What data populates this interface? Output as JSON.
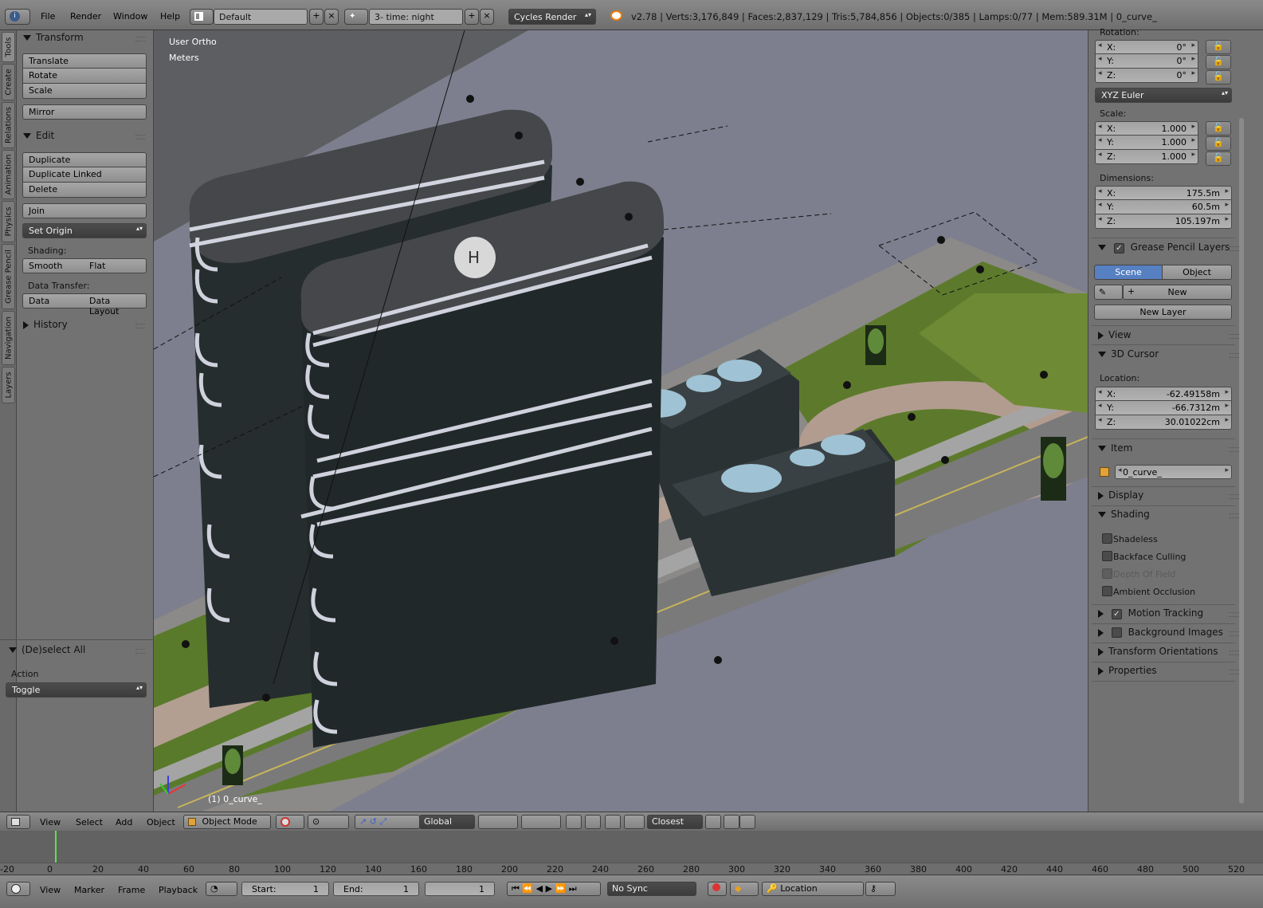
{
  "topbar": {
    "menus": [
      "File",
      "Render",
      "Window",
      "Help"
    ],
    "layout": "Default",
    "scene": "3- time: night",
    "engine": "Cycles Render",
    "stats": "v2.78 | Verts:3,176,849 | Faces:2,837,129 | Tris:5,784,856 | Objects:0/385 | Lamps:0/77 | Mem:589.31M | 0_curve_"
  },
  "tabs": [
    "Tools",
    "Create",
    "Relations",
    "Animation",
    "Physics",
    "Grease Pencil",
    "Navigation",
    "Layers"
  ],
  "toolshelf": {
    "transform": {
      "title": "Transform",
      "buttons": [
        "Translate",
        "Rotate",
        "Scale",
        "Mirror"
      ]
    },
    "edit": {
      "title": "Edit",
      "buttons": [
        "Duplicate",
        "Duplicate Linked",
        "Delete",
        "Join"
      ],
      "set_origin": "Set Origin"
    },
    "shading": {
      "label": "Shading:",
      "smooth": "Smooth",
      "flat": "Flat"
    },
    "data_transfer": {
      "label": "Data Transfer:",
      "data": "Data",
      "data_layout": "Data Layout"
    },
    "history": "History",
    "operator": {
      "title": "(De)select All",
      "action_label": "Action",
      "action_value": "Toggle"
    }
  },
  "viewport": {
    "view_name": "User Ortho",
    "units": "Meters",
    "object_label": "(1) 0_curve_"
  },
  "props": {
    "rotation": {
      "label": "Rotation:",
      "x": "0°",
      "y": "0°",
      "z": "0°",
      "mode": "XYZ Euler"
    },
    "scale": {
      "label": "Scale:",
      "x": "1.000",
      "y": "1.000",
      "z": "1.000"
    },
    "dimensions": {
      "label": "Dimensions:",
      "x": "175.5m",
      "y": "60.5m",
      "z": "105.197m"
    },
    "axis": {
      "x": "X:",
      "y": "Y:",
      "z": "Z:"
    },
    "grease_pencil": {
      "title": "Grease Pencil Layers",
      "scene": "Scene",
      "object": "Object",
      "new": "New",
      "new_layer": "New Layer"
    },
    "view": "View",
    "cursor": {
      "title": "3D Cursor",
      "location_label": "Location:",
      "x": "-62.49158m",
      "y": "-66.7312m",
      "z": "30.01022cm"
    },
    "item": {
      "title": "Item",
      "name": "0_curve_"
    },
    "display": "Display",
    "shading": {
      "title": "Shading",
      "shadeless": "Shadeless",
      "backface": "Backface Culling",
      "dof": "Depth Of Field",
      "ao": "Ambient Occlusion"
    },
    "motion_tracking": "Motion Tracking",
    "background_images": "Background Images",
    "transform_orientations": "Transform Orientations",
    "properties": "Properties"
  },
  "vpheader": {
    "menus": [
      "View",
      "Select",
      "Add",
      "Object"
    ],
    "mode": "Object Mode",
    "orientation": "Global",
    "snap": "Closest"
  },
  "timeline": {
    "ticks": [
      "-20",
      "0",
      "20",
      "40",
      "60",
      "80",
      "100",
      "120",
      "140",
      "160",
      "180",
      "200",
      "220",
      "240",
      "260",
      "280",
      "300",
      "320",
      "340",
      "360",
      "380",
      "400",
      "420",
      "440",
      "460",
      "480",
      "500",
      "520"
    ],
    "current_frame": 1
  },
  "tlheader": {
    "menus": [
      "View",
      "Marker",
      "Frame",
      "Playback"
    ],
    "start_label": "Start:",
    "start_value": "1",
    "end_label": "End:",
    "end_value": "1",
    "frame": "1",
    "sync": "No Sync",
    "keying": "Location"
  },
  "colors": {
    "ui_bg": "#727272",
    "viewport": "#7d7f8e",
    "accent_blue": "#5680c2",
    "playhead": "#5be04c",
    "grass": "#5c7a2a",
    "building": "#2f3638"
  }
}
